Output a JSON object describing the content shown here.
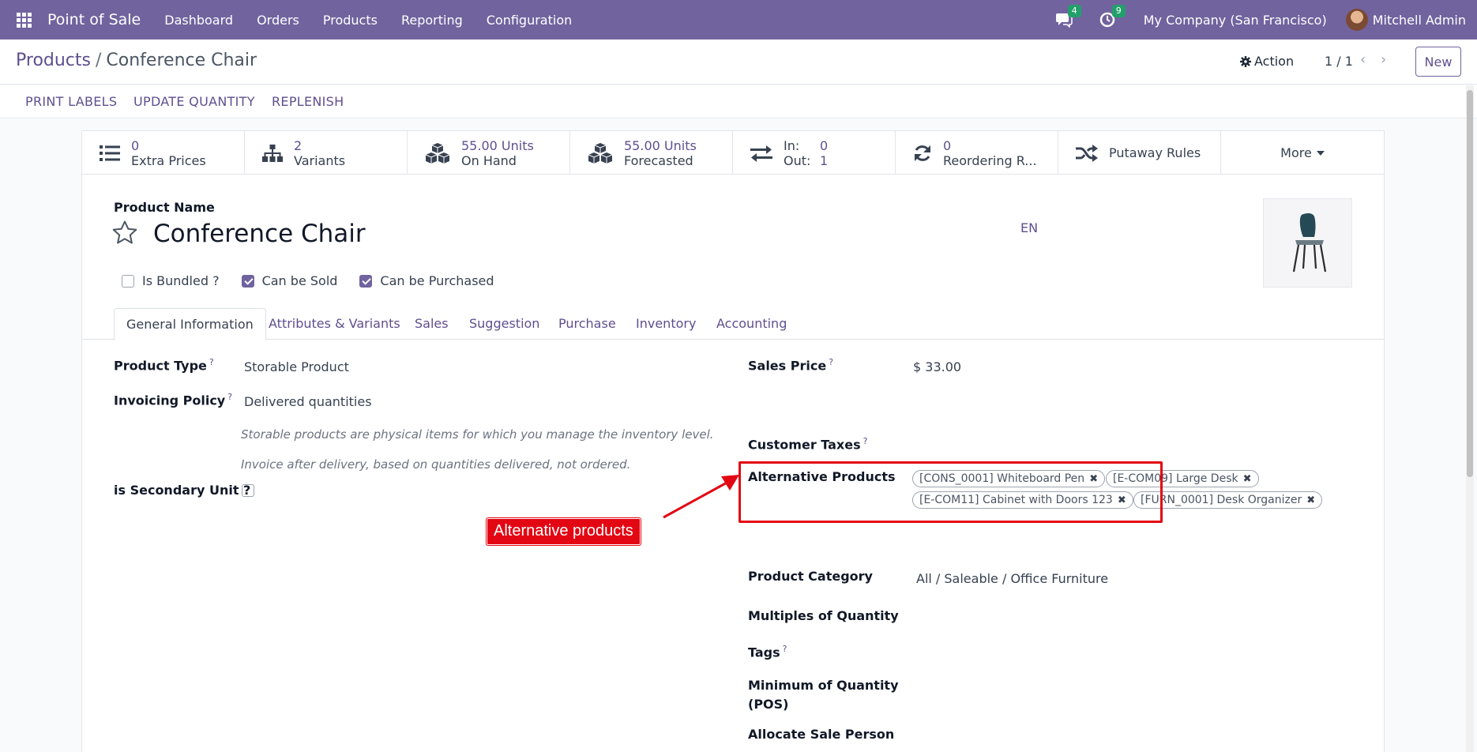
{
  "nav": {
    "brand": "Point of Sale",
    "menu": [
      "Dashboard",
      "Orders",
      "Products",
      "Reporting",
      "Configuration"
    ],
    "messages_badge": "4",
    "activities_badge": "9",
    "company": "My Company (San Francisco)",
    "user": "Mitchell Admin"
  },
  "breadcrumb": {
    "parent": "Products",
    "separator": "/",
    "current": "Conference Chair"
  },
  "control": {
    "action_label": "Action",
    "pager": "1 / 1",
    "new_label": "New"
  },
  "actions": [
    "PRINT LABELS",
    "UPDATE QUANTITY",
    "REPLENISH"
  ],
  "smart_buttons": {
    "extra_prices": {
      "value": "0",
      "label": "Extra Prices"
    },
    "variants": {
      "value": "2",
      "label": "Variants"
    },
    "on_hand": {
      "value": "55.00 Units",
      "label": "On Hand"
    },
    "forecasted": {
      "value": "55.00 Units",
      "label": "Forecasted"
    },
    "in_out": {
      "in_label": "In:",
      "in_value": "0",
      "out_label": "Out:",
      "out_value": "1"
    },
    "reordering": {
      "value": "0",
      "label": "Reordering R..."
    },
    "putaway": {
      "label": "Putaway Rules"
    },
    "more": {
      "label": "More"
    }
  },
  "product": {
    "name_label": "Product Name",
    "name": "Conference Chair",
    "lang": "EN",
    "checks": {
      "is_bundled": "Is Bundled ?",
      "can_be_sold": "Can be Sold",
      "can_be_purchased": "Can be Purchased"
    }
  },
  "tabs": [
    "General Information",
    "Attributes & Variants",
    "Sales",
    "Suggestion",
    "Purchase",
    "Inventory",
    "Accounting"
  ],
  "fields": {
    "product_type": {
      "label": "Product Type",
      "value": "Storable Product"
    },
    "invoicing_policy": {
      "label": "Invoicing Policy",
      "value": "Delivered quantities"
    },
    "help_storable": "Storable products are physical items for which you manage the inventory level.",
    "help_invoice": "Invoice after delivery, based on quantities delivered, not ordered.",
    "secondary_unit": {
      "label": "is Secondary Unit ?"
    },
    "sales_price": {
      "label": "Sales Price",
      "value": "$ 33.00"
    },
    "customer_taxes": {
      "label": "Customer Taxes"
    },
    "alternative_products": {
      "label": "Alternative Products",
      "tags": [
        "[CONS_0001] Whiteboard Pen",
        "[E-COM09] Large Desk",
        "[E-COM11] Cabinet with Doors 123",
        "[FURN_0001] Desk Organizer"
      ]
    },
    "product_category": {
      "label": "Product Category",
      "value": "All / Saleable / Office Furniture"
    },
    "multiples_of_quantity": {
      "label": "Multiples of Quantity"
    },
    "tags": {
      "label": "Tags"
    },
    "min_qty_pos_line1": "Minimum of Quantity",
    "min_qty_pos_line2": "(POS)",
    "allocate_sale_person": {
      "label": "Allocate Sale Person"
    }
  },
  "annotation": {
    "text": "Alternative products",
    "color": "#e30613"
  },
  "colors": {
    "brand": "#71639e",
    "link": "#5f4f8f",
    "badge": "#22a06b"
  },
  "help_mark": "?",
  "tag_remove": "✖"
}
